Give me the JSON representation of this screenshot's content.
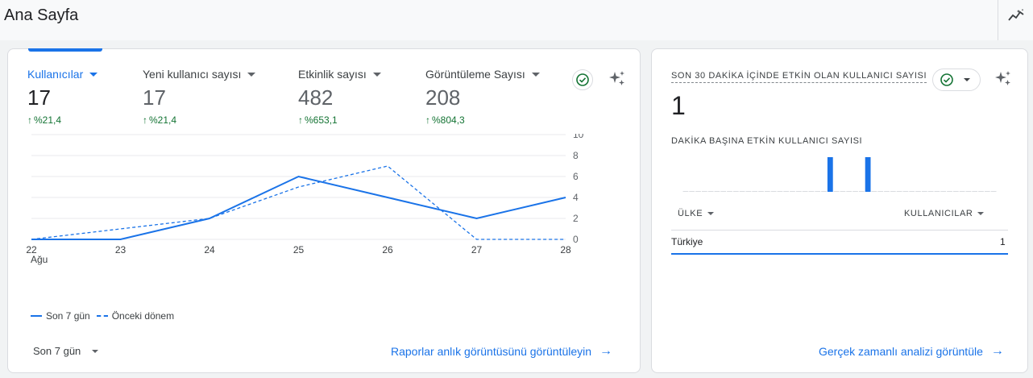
{
  "header": {
    "title": "Ana Sayfa"
  },
  "overview": {
    "metrics": [
      {
        "label": "Kullanıcılar",
        "value": "17",
        "change": "%21,4",
        "active": true
      },
      {
        "label": "Yeni kullanıcı sayısı",
        "value": "17",
        "change": "%21,4",
        "active": false
      },
      {
        "label": "Etkinlik sayısı",
        "value": "482",
        "change": "%653,1",
        "active": false
      },
      {
        "label": "Görüntüleme Sayısı",
        "value": "208",
        "change": "%804,3",
        "active": false
      }
    ],
    "legend": {
      "current": "Son 7 gün",
      "previous": "Önceki dönem"
    },
    "date_range": "Son 7 gün",
    "link": "Raporlar anlık görüntüsünü görüntüleyin"
  },
  "chart_data": {
    "type": "line",
    "x": [
      "22",
      "23",
      "24",
      "25",
      "26",
      "27",
      "28"
    ],
    "x_sub_label": "Ağu",
    "y_ticks": [
      0,
      2,
      4,
      6,
      8,
      10
    ],
    "ylim": [
      0,
      10
    ],
    "grid": true,
    "legend_position": "bottom-left",
    "series": [
      {
        "name": "Son 7 gün",
        "values": [
          0,
          0,
          2,
          6,
          4,
          2,
          4
        ],
        "style": "solid"
      },
      {
        "name": "Önceki dönem",
        "values": [
          0,
          1,
          2,
          5,
          7,
          0,
          0
        ],
        "style": "dashed"
      }
    ],
    "color": "#1a73e8"
  },
  "realtime": {
    "title": "SON 30 DAKİKA İÇİNDE ETKİN OLAN KULLANICI SAYISI",
    "value": "1",
    "subtitle": "DAKİKA BAŞINA ETKİN KULLANICI SAYISI",
    "bars": [
      0,
      0,
      0,
      0,
      0,
      0,
      0,
      0,
      0,
      0,
      0,
      0,
      0,
      0,
      0,
      0,
      0,
      0,
      0,
      0,
      0,
      0,
      0,
      1,
      0,
      0,
      0,
      0,
      0,
      1,
      0,
      0,
      0,
      0,
      0,
      0,
      0,
      0,
      0,
      0,
      0,
      0,
      0,
      0,
      0,
      0,
      0,
      0,
      0,
      0
    ],
    "table": {
      "col_country": "ÜLKE",
      "col_users": "KULLANICILAR",
      "rows": [
        {
          "country": "Türkiye",
          "users": "1"
        }
      ]
    },
    "link": "Gerçek zamanlı analizi görüntüle"
  },
  "colors": {
    "accent": "#1a73e8",
    "positive": "#137333"
  }
}
